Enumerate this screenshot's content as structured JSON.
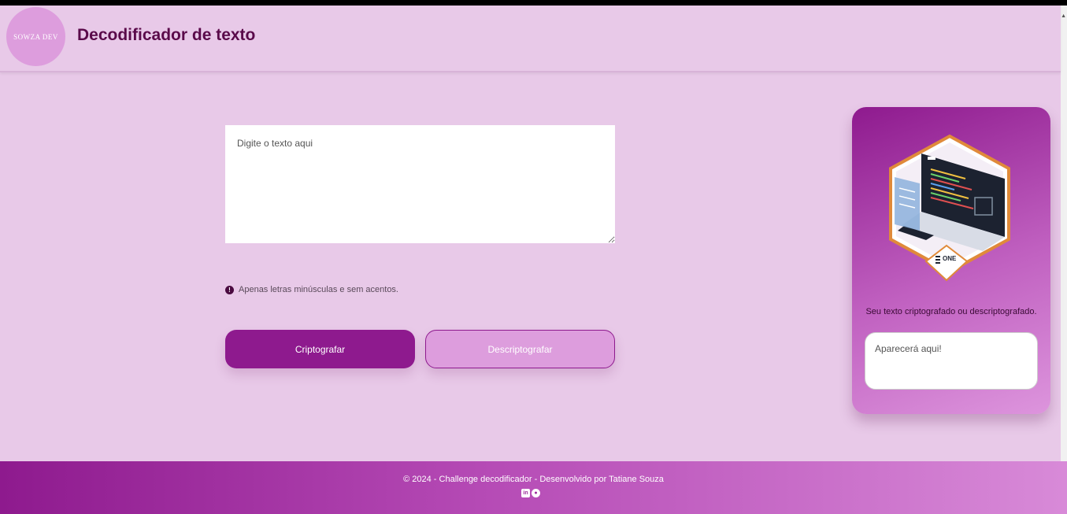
{
  "header": {
    "logo_text": "SOWZA DEV",
    "title": "Decodificador de texto"
  },
  "input": {
    "placeholder": "Digite o texto aqui"
  },
  "hint": {
    "icon": "exclamation-circle-icon",
    "text": "Apenas letras minúsculas e sem acentos."
  },
  "buttons": {
    "encrypt_label": "Criptografar",
    "decrypt_label": "Descriptografar"
  },
  "panel": {
    "badge_text": "ONE",
    "caption": "Seu texto criptografado ou descriptografado.",
    "output_placeholder": "Aparecerá aqui!"
  },
  "footer": {
    "text": "© 2024 - Challenge decodificador - Desenvolvido por Tatiane Souza",
    "icons": [
      "linkedin-icon",
      "github-icon"
    ]
  },
  "colors": {
    "background": "#e8c9e8",
    "primary": "#8e1a8e",
    "secondary": "#dd9ddd",
    "title": "#5a0a4a"
  }
}
